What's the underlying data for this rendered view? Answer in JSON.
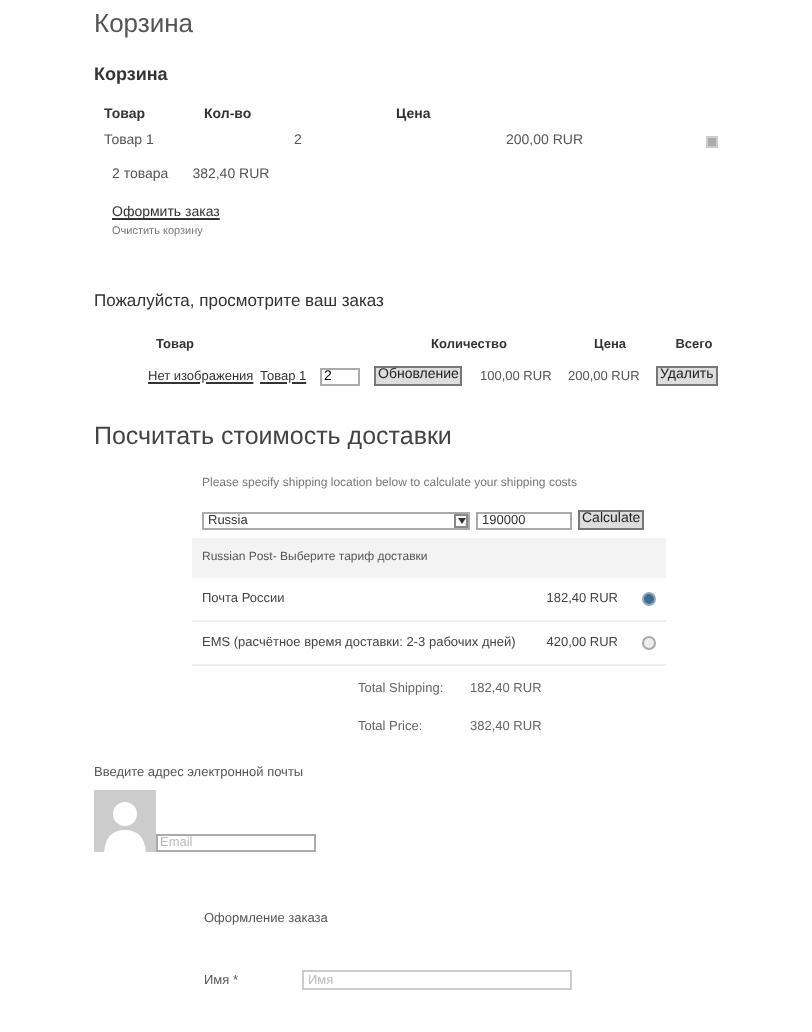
{
  "page_title": "Корзина",
  "mini_cart": {
    "title": "Корзина",
    "columns": [
      "Товар",
      "Кол-во",
      "Цена"
    ],
    "rows": [
      {
        "product": "Товар 1",
        "quantity": "2",
        "price": "200,00 RUR"
      }
    ],
    "summary": {
      "count": "2 товара",
      "total": "382,40 RUR"
    },
    "checkout_link": "Оформить заказ",
    "clear_link": "Очистить корзину"
  },
  "review": {
    "title": "Пожалуйста, просмотрите ваш заказ",
    "columns": [
      "Товар",
      "Количество",
      "Цена",
      "Всего"
    ],
    "rows": [
      {
        "image": "Нет изображения",
        "product": "Товар 1",
        "quantity": "2",
        "update": "Обновление",
        "price": "100,00 RUR",
        "total": "200,00 RUR",
        "remove": "Удалить"
      }
    ]
  },
  "shipping": {
    "title": "Посчитать стоимость доставки",
    "hint": "Please specify shipping location below to calculate your shipping costs",
    "country": "Russia",
    "postcode": "190000",
    "calculate": "Calculate",
    "carrier": "Russian Post- Выберите тариф доставки",
    "options": [
      {
        "name": "Почта России",
        "price": "182,40 RUR",
        "selected": true
      },
      {
        "name": "EMS (расчётное время доставки: 2-3 рабочих дней)",
        "price": "420,00 RUR",
        "selected": false
      }
    ],
    "totals": [
      {
        "label": "Total Shipping:",
        "value": "182,40 RUR"
      },
      {
        "label": "Total Price:",
        "value": "382,40 RUR"
      }
    ]
  },
  "email": {
    "label": "Введите адрес электронной почты",
    "placeholder": "Email"
  },
  "checkout": {
    "title": "Оформление заказа",
    "fields": [
      {
        "label": "Имя *",
        "placeholder": "Имя"
      }
    ]
  }
}
